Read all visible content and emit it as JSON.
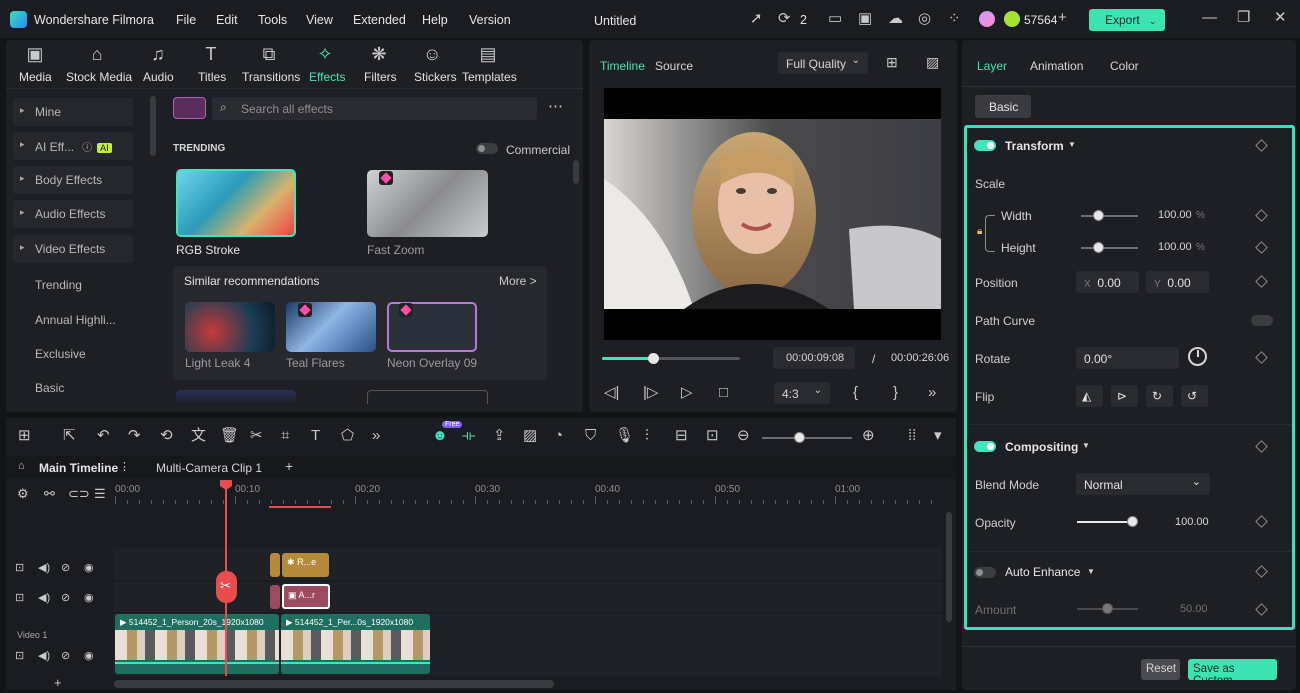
{
  "app": {
    "name": "Wondershare Filmora",
    "project_title": "Untitled",
    "menu": [
      "File",
      "Edit",
      "Tools",
      "View",
      "Extended",
      "Help",
      "Version"
    ],
    "render_count": "2",
    "credits": "57564",
    "export_label": "Export"
  },
  "media_tabs": [
    {
      "label": "Media",
      "icon": "media-icon"
    },
    {
      "label": "Stock Media",
      "icon": "stock-media-icon"
    },
    {
      "label": "Audio",
      "icon": "audio-icon"
    },
    {
      "label": "Titles",
      "icon": "titles-icon"
    },
    {
      "label": "Transitions",
      "icon": "transitions-icon"
    },
    {
      "label": "Effects",
      "icon": "effects-icon",
      "active": true
    },
    {
      "label": "Filters",
      "icon": "filters-icon"
    },
    {
      "label": "Stickers",
      "icon": "stickers-icon"
    },
    {
      "label": "Templates",
      "icon": "templates-icon"
    }
  ],
  "sidebar": {
    "items": [
      "Mine",
      "AI Eff...",
      "Body Effects",
      "Audio Effects",
      "Video Effects"
    ],
    "ai_badge": "AI",
    "sub_items": [
      "Trending",
      "Annual Highli...",
      "Exclusive",
      "Basic"
    ]
  },
  "effects": {
    "search_placeholder": "Search all effects",
    "section": "TRENDING",
    "commercial_label": "Commercial",
    "cards": [
      "RGB Stroke",
      "Fast Zoom"
    ],
    "similar_title": "Similar recommendations",
    "more_label": "More >",
    "similar": [
      "Light Leak 4",
      "Teal Flares",
      "Neon Overlay 09"
    ]
  },
  "preview": {
    "tabs": [
      "Timeline",
      "Source"
    ],
    "quality": "Full Quality",
    "current_time": "00:00:09:08",
    "total_time": "00:00:26:06",
    "separator": "/",
    "aspect": "4:3",
    "progress": 0.37
  },
  "right_panel": {
    "tabs": [
      "Layer",
      "Animation",
      "Color"
    ],
    "basic_label": "Basic",
    "transform": {
      "title": "Transform",
      "scale_label": "Scale",
      "width_label": "Width",
      "width_value": "100.00",
      "height_label": "Height",
      "height_value": "100.00",
      "percent": "%",
      "position_label": "Position",
      "x_label": "X",
      "x_value": "0.00",
      "y_label": "Y",
      "y_value": "0.00",
      "path_curve_label": "Path Curve",
      "rotate_label": "Rotate",
      "rotate_value": "0.00°",
      "flip_label": "Flip"
    },
    "compositing": {
      "title": "Compositing",
      "blend_label": "Blend Mode",
      "blend_value": "Normal",
      "opacity_label": "Opacity",
      "opacity_value": "100.00"
    },
    "auto_enhance": {
      "title": "Auto Enhance",
      "amount_label": "Amount",
      "amount_value": "50.00"
    },
    "reset_label": "Reset",
    "save_label": "Save as Custom"
  },
  "timeline": {
    "tabs": [
      "Main Timeline",
      "Multi-Camera Clip 1"
    ],
    "ticks": [
      "00:00",
      "00:10",
      "00:20",
      "00:30",
      "00:40",
      "00:50",
      "01:00"
    ],
    "free_badge": "Free",
    "track_label": "Video 1",
    "clip1": "514452_1_Person_20s_1920x1080",
    "clip2": "514452_1_Per...0s_1920x1080",
    "fx_clip": "R...e",
    "text_clip": "A...r"
  },
  "colors": {
    "accent": "#43e3bd",
    "export_bg": "#3de4b3",
    "highlight_border": "#3fe0bf",
    "playhead": "#e94c4c"
  }
}
